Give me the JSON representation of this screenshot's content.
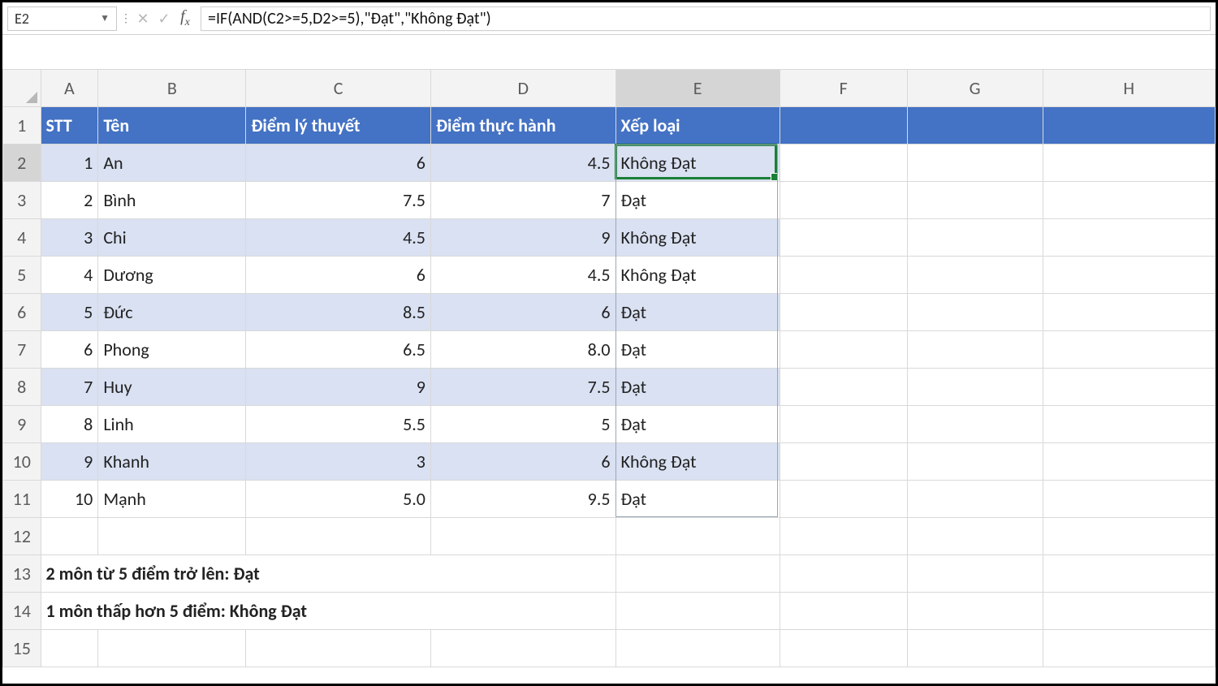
{
  "name_box": "E2",
  "formula": "=IF(AND(C2>=5,D2>=5),\"Đạt\",\"Không Đạt\")",
  "columns": [
    "A",
    "B",
    "C",
    "D",
    "E",
    "F",
    "G",
    "H"
  ],
  "row_numbers": [
    "1",
    "2",
    "3",
    "4",
    "5",
    "6",
    "7",
    "8",
    "9",
    "10",
    "11",
    "12",
    "13",
    "14",
    "15"
  ],
  "active_cell": "E2",
  "headers": {
    "stt": "STT",
    "ten": "Tên",
    "ly_thuyet": "Điểm lý thuyết",
    "thuc_hanh": "Điểm thực hành",
    "xep_loai": "Xếp loại"
  },
  "rows": [
    {
      "stt": "1",
      "ten": "An",
      "lt": "6",
      "th": "4.5",
      "xl": "Không Đạt"
    },
    {
      "stt": "2",
      "ten": "Bình",
      "lt": "7.5",
      "th": "7",
      "xl": "Đạt"
    },
    {
      "stt": "3",
      "ten": "Chi",
      "lt": "4.5",
      "th": "9",
      "xl": "Không Đạt"
    },
    {
      "stt": "4",
      "ten": "Dương",
      "lt": "6",
      "th": "4.5",
      "xl": "Không Đạt"
    },
    {
      "stt": "5",
      "ten": "Đức",
      "lt": "8.5",
      "th": "6",
      "xl": "Đạt"
    },
    {
      "stt": "6",
      "ten": "Phong",
      "lt": "6.5",
      "th": "8.0",
      "xl": "Đạt"
    },
    {
      "stt": "7",
      "ten": "Huy",
      "lt": "9",
      "th": "7.5",
      "xl": "Đạt"
    },
    {
      "stt": "8",
      "ten": "Linh",
      "lt": "5.5",
      "th": "5",
      "xl": "Đạt"
    },
    {
      "stt": "9",
      "ten": "Khanh",
      "lt": "3",
      "th": "6",
      "xl": "Không Đạt"
    },
    {
      "stt": "10",
      "ten": "Mạnh",
      "lt": "5.0",
      "th": "9.5",
      "xl": "Đạt"
    }
  ],
  "notes": {
    "n13": "2 môn từ 5 điểm trở lên: Đạt",
    "n14": "1 môn thấp hơn 5 điểm: Không Đạt"
  }
}
